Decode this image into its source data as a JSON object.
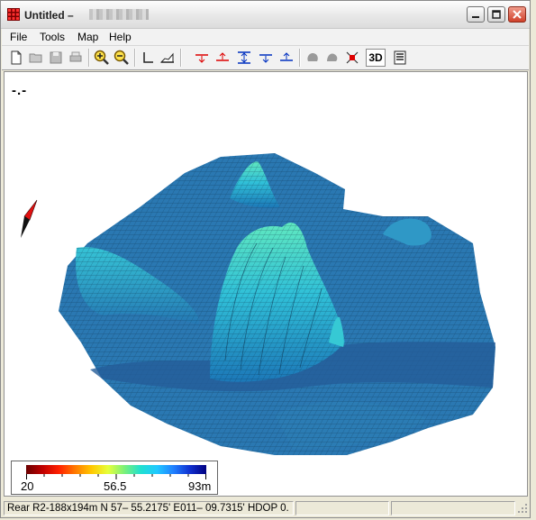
{
  "window": {
    "title": "Untitled –",
    "title_suffix_redacted": true
  },
  "menu": {
    "items": [
      "File",
      "Tools",
      "Map",
      "Help"
    ]
  },
  "toolbar": {
    "buttons": [
      "new-file-icon",
      "open-folder-icon",
      "save-icon",
      "print-icon",
      "zoom-in-icon",
      "zoom-out-icon",
      "axis-icon",
      "area-profile-icon",
      "depth-down-red-icon",
      "depth-up-red-icon",
      "depth-range-blue-icon",
      "depth-down-blue-icon",
      "depth-up-blue-icon",
      "shape-gray-1-icon",
      "shape-gray-2-icon",
      "stop-marker-icon"
    ],
    "three_d_label": "3D",
    "list_icon": "list-icon"
  },
  "view": {
    "readout": "-.-",
    "compass_icon": "compass-icon",
    "colors": {
      "terrain_low": "#1f5f9a",
      "terrain_mid": "#2a8fbf",
      "terrain_high": "#34d6c8",
      "compass_red": "#e01010"
    }
  },
  "legend": {
    "min": "20",
    "mid": "56.5",
    "max": "93m"
  },
  "status": {
    "pane1": "Rear R2-188x194m  N 57– 55.2175'  E011– 09.7315'  HDOP 0.",
    "pane2": "",
    "pane3": ""
  }
}
